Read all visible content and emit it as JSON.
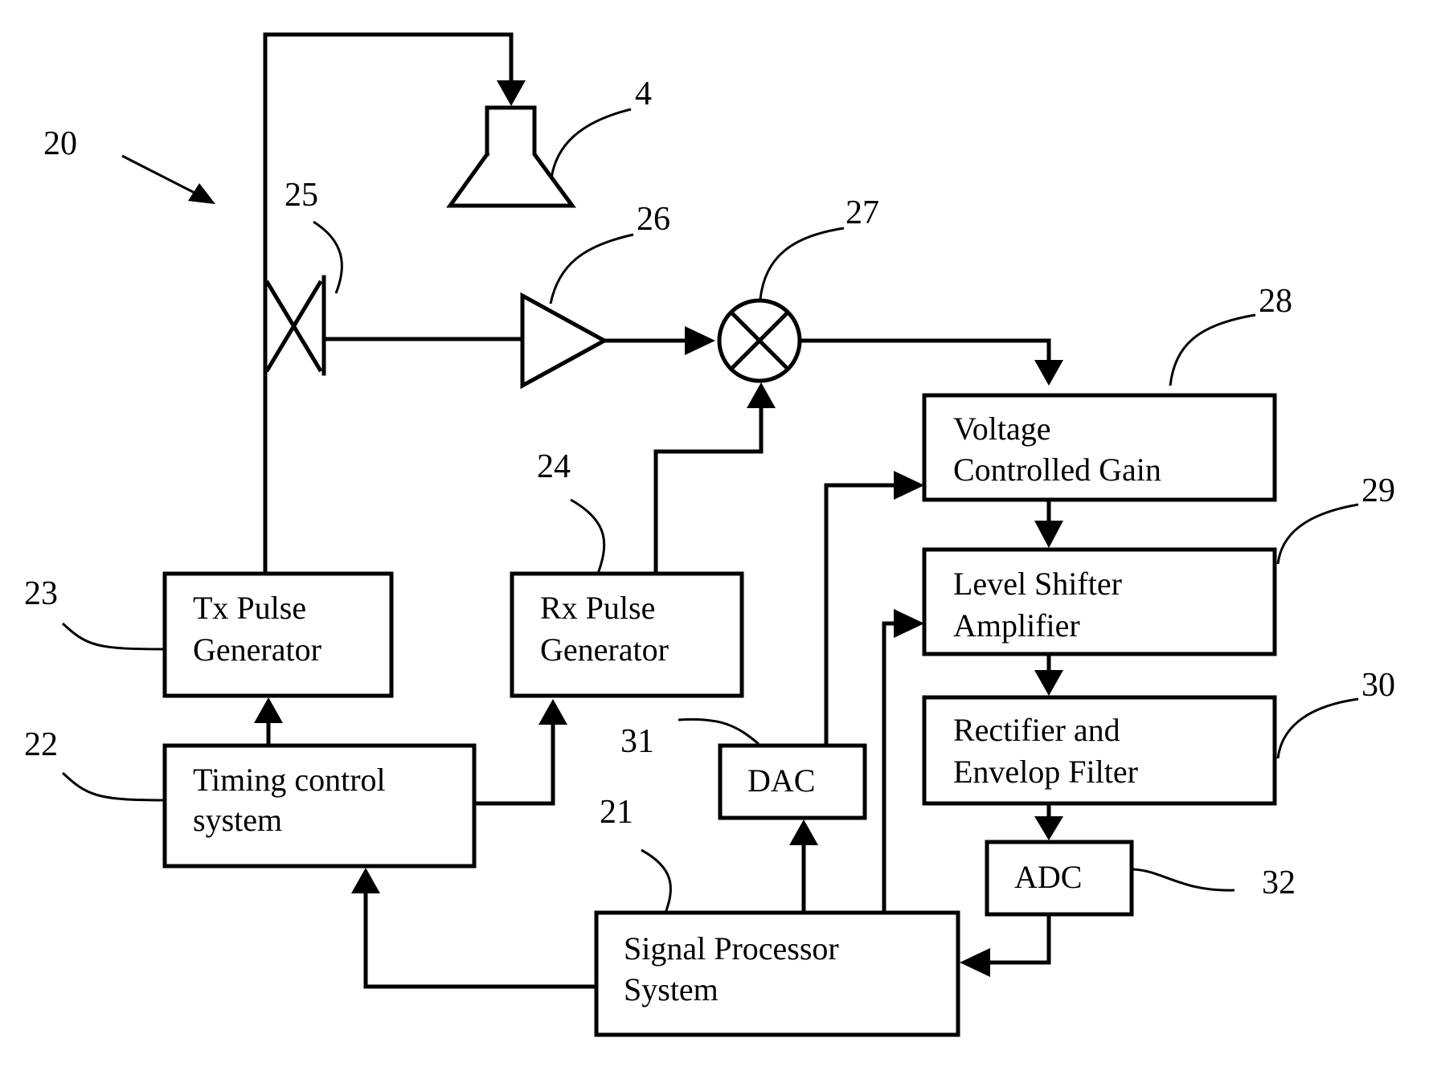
{
  "figure": {
    "system_ref": "20",
    "blocks": {
      "tx_pulse": {
        "ref": "23",
        "line1": "Tx Pulse",
        "line2": "Generator"
      },
      "rx_pulse": {
        "ref": "24",
        "line1": "Rx Pulse",
        "line2": "Generator"
      },
      "timing": {
        "ref": "22",
        "line1": "Timing control",
        "line2": "system"
      },
      "signal_processor": {
        "ref": "21",
        "line1": "Signal Processor",
        "line2": "System"
      },
      "dac": {
        "ref": "31",
        "label": "DAC"
      },
      "adc": {
        "ref": "32",
        "label": "ADC"
      },
      "vcg": {
        "ref": "28",
        "line1": "Voltage",
        "line2": "Controlled Gain"
      },
      "level_shifter": {
        "ref": "29",
        "line1": "Level Shifter",
        "line2": "Amplifier"
      },
      "rectifier": {
        "ref": "30",
        "line1": "Rectifier and",
        "line2": "Envelop Filter"
      }
    },
    "components": {
      "antenna": {
        "ref": "4"
      },
      "switch": {
        "ref": "25"
      },
      "amplifier": {
        "ref": "26"
      },
      "mixer": {
        "ref": "27"
      }
    }
  }
}
